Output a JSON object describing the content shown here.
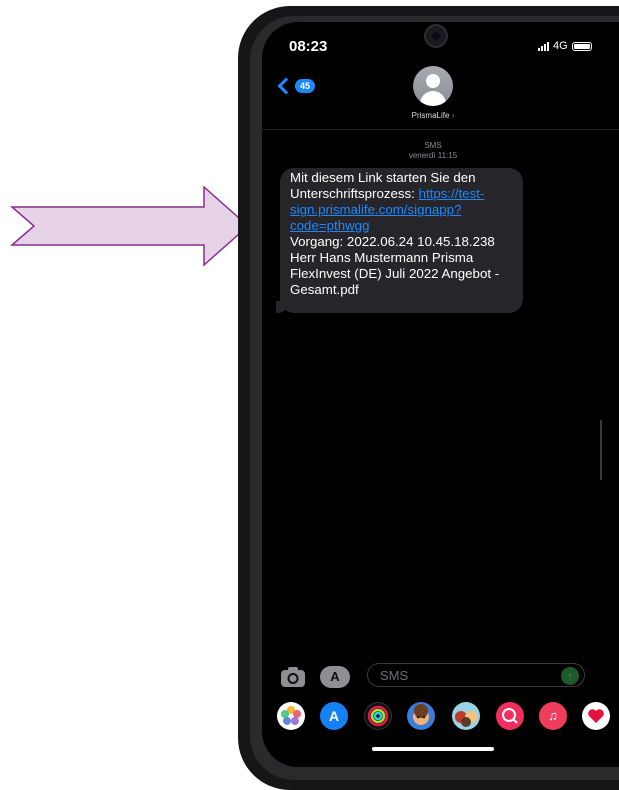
{
  "status_bar": {
    "time": "08:23",
    "network": "4G"
  },
  "header": {
    "back_count": "45",
    "contact_name": "PrismaLife",
    "contact_chevron": "›"
  },
  "conversation": {
    "channel": "SMS",
    "timestamp": "venerdì 11:15",
    "message": {
      "line1": "Mit diesem Link starten Sie den",
      "line2_text": "Unterschriftsprozess: ",
      "link_part1": "https://test-",
      "link_part2": "sign.prismalife.com/signapp?",
      "link_part3": "code=pthwgg",
      "line_vorgang": "Vorgang: 2022.06.24 10.45.18.238",
      "line_herr": "Herr Hans Mustermann Prisma",
      "line_flex": "FlexInvest (DE) Juli 2022 Angebot -",
      "line_file": "Gesamt.pdf"
    }
  },
  "input": {
    "placeholder": "SMS",
    "value": ""
  },
  "app_tray": [
    {
      "name": "photos-icon"
    },
    {
      "name": "app-store-icon"
    },
    {
      "name": "fitness-rings-icon"
    },
    {
      "name": "memoji-icon"
    },
    {
      "name": "animoji-icon"
    },
    {
      "name": "web-search-icon"
    },
    {
      "name": "music-icon"
    },
    {
      "name": "heart-icon"
    }
  ],
  "colors": {
    "accent": "#1e88ff",
    "bubble": "#26262a",
    "arrow_fill": "#e6d3e8",
    "arrow_stroke": "#8a2d8c"
  }
}
